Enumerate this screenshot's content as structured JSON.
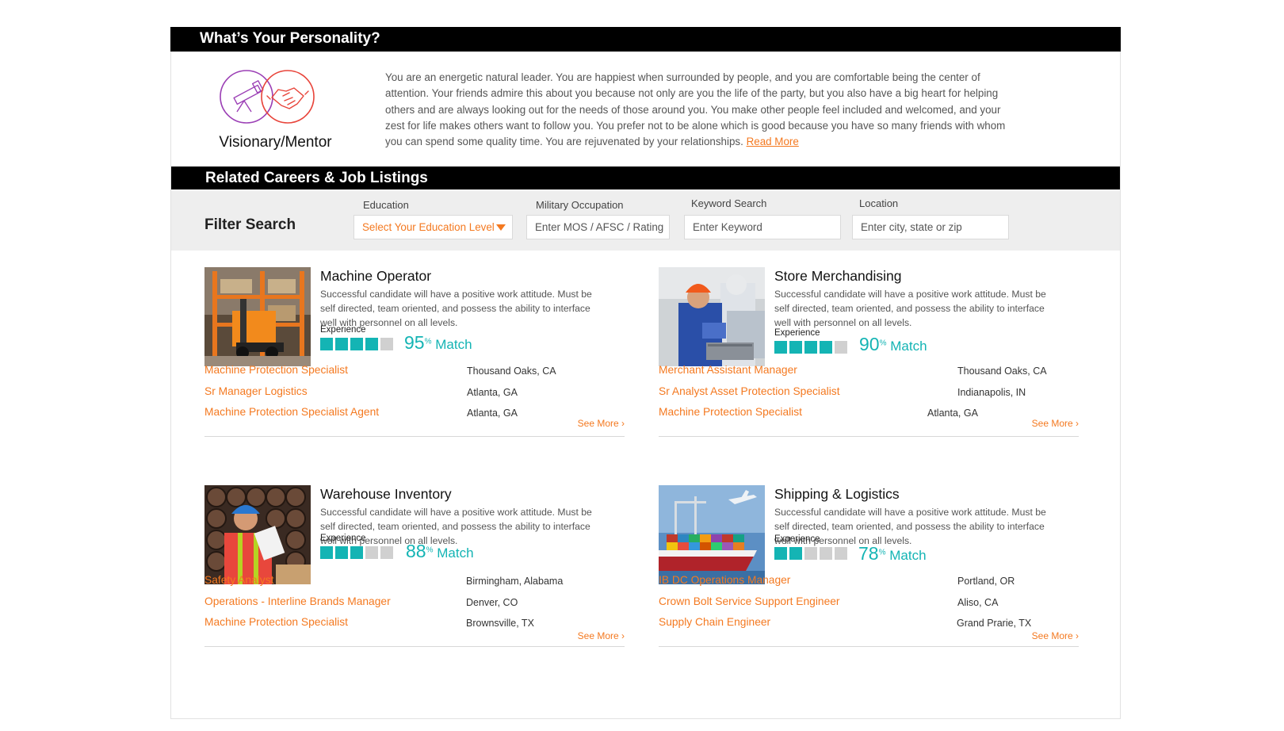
{
  "personality": {
    "header": "What’s Your Personality?",
    "name": "Visionary/Mentor",
    "description": "You are an energetic natural leader. You are happiest when surrounded by people, and you are comfortable being the center of attention. Your friends admire this about you because not only are you the life of the party, but you also have a big heart for helping others and are always looking out for the needs of those around you. You make other people feel included and welcomed, and your zest for life makes others want to follow you. You prefer not to be alone which is good because you have so many friends with whom you can spend some quality time. You are rejuvenated by your relationships.",
    "read_more": "Read More",
    "icons": [
      "telescope-icon",
      "handshake-icon"
    ],
    "colors": {
      "left_circle": "#9b3fb5",
      "right_circle": "#e8443a"
    }
  },
  "related": {
    "header": "Related Careers & Job Listings"
  },
  "filter": {
    "title": "Filter Search",
    "education": {
      "label": "Education",
      "value": "Select Your Education Level"
    },
    "military": {
      "label": "Military Occupation",
      "placeholder": "Enter MOS / AFSC / Rating"
    },
    "keyword": {
      "label": "Keyword Search",
      "placeholder": "Enter Keyword"
    },
    "location": {
      "label": "Location",
      "placeholder": "Enter city, state or zip"
    }
  },
  "colors": {
    "accent": "#f47920",
    "match": "#14b4b4",
    "bar": "#000000"
  },
  "careers": [
    {
      "title": "Machine Operator",
      "description": "Successful candidate will have a positive work attitude. Must be self directed, team oriented, and possess the ability to interface well with personnel on all levels.",
      "experience_label": "Experience",
      "experience_level": 4,
      "match_pct": "95",
      "pct_sign": "%",
      "match_word": "Match",
      "jobs": [
        {
          "title": "Machine Protection Specialist",
          "location": "Thousand Oaks, CA"
        },
        {
          "title": "Sr Manager Logistics",
          "location": "Atlanta, GA"
        },
        {
          "title": "Machine Protection Specialist Agent",
          "location": "Atlanta, GA"
        }
      ],
      "see_more": "See More ›"
    },
    {
      "title": "Store Merchandising",
      "description": "Successful candidate will have a positive work attitude. Must be self directed, team oriented, and possess the ability to interface well with personnel on all levels.",
      "experience_label": "Experience",
      "experience_level": 4,
      "match_pct": "90",
      "pct_sign": "%",
      "match_word": "Match",
      "jobs": [
        {
          "title": "Merchant Assistant Manager",
          "location": "Thousand Oaks, CA"
        },
        {
          "title": "Sr Analyst Asset Protection Specialist",
          "location": "Indianapolis, IN"
        },
        {
          "title": "Machine Protection Specialist",
          "location": "Atlanta, GA"
        }
      ],
      "see_more": "See More ›"
    },
    {
      "title": "Warehouse Inventory",
      "description": "Successful candidate will have a positive work attitude. Must be self directed, team oriented, and possess the ability to interface well with personnel on all levels.",
      "experience_label": "Experience",
      "experience_level": 3,
      "match_pct": "88",
      "pct_sign": "%",
      "match_word": "Match",
      "jobs": [
        {
          "title": "Safety Analyst",
          "location": "Birmingham, Alabama"
        },
        {
          "title": "Operations - Interline Brands Manager",
          "location": "Denver, CO"
        },
        {
          "title": "Machine Protection Specialist",
          "location": "Brownsville, TX"
        }
      ],
      "see_more": "See More ›"
    },
    {
      "title": "Shipping & Logistics",
      "description": "Successful candidate will have a positive work attitude. Must be self directed, team oriented, and possess the ability to interface well with personnel on all levels.",
      "experience_label": "Experience",
      "experience_level": 2,
      "match_pct": "78",
      "pct_sign": "%",
      "match_word": "Match",
      "jobs": [
        {
          "title": "IB DC Operations Manager",
          "location": "Portland, OR"
        },
        {
          "title": "Crown Bolt Service Support Engineer",
          "location": "Aliso, CA"
        },
        {
          "title": "Supply Chain Engineer",
          "location": "Grand Prarie, TX"
        }
      ],
      "see_more": "See More ›"
    }
  ]
}
